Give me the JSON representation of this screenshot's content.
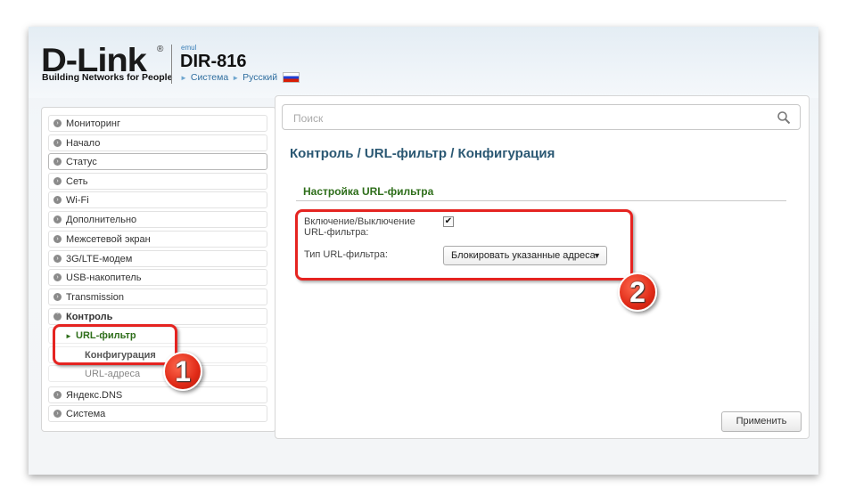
{
  "header": {
    "logo": "D-Link",
    "logo_mark": "®",
    "tagline": "Building Networks for People",
    "model_prefix": "emul",
    "model": "DIR-816",
    "breadcrumb": [
      "Система",
      "Русский"
    ],
    "language_flag": "russia-flag-icon"
  },
  "sidebar": {
    "items": [
      {
        "label": "Мониторинг"
      },
      {
        "label": "Начало"
      },
      {
        "label": "Статус"
      },
      {
        "label": "Сеть"
      },
      {
        "label": "Wi-Fi"
      },
      {
        "label": "Дополнительно"
      },
      {
        "label": "Межсетевой экран"
      },
      {
        "label": "3G/LTE-модем"
      },
      {
        "label": "USB-накопитель"
      },
      {
        "label": "Transmission"
      },
      {
        "label": "Контроль"
      },
      {
        "label": "Яндекс.DNS"
      },
      {
        "label": "Система"
      }
    ],
    "control_sub": {
      "url_filter": "URL-фильтр",
      "config": "Конфигурация",
      "addresses": "URL-адреса"
    }
  },
  "search": {
    "placeholder": "Поиск",
    "value": ""
  },
  "main": {
    "title": "Контроль /  URL-фильтр /  Конфигурация",
    "section": "Настройка URL-фильтра",
    "enable_label": "Включение/Выключение URL-фильтра:",
    "enable_checked": true,
    "type_label": "Тип URL-фильтра:",
    "type_value": "Блокировать указанные адреса",
    "apply_label": "Применить"
  },
  "annotations": {
    "badge1": "1",
    "badge2": "2",
    "color": "#e52421"
  }
}
